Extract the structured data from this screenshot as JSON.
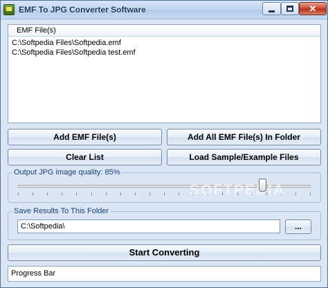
{
  "window": {
    "title": "EMF To JPG Converter Software",
    "close_glyph": "✕"
  },
  "file_list": {
    "header": "EMF File(s)",
    "items": [
      "C:\\Softpedia Files\\Softpedia.emf",
      "C:\\Softpedia Files\\Softpedia test.emf"
    ]
  },
  "buttons": {
    "add_files": "Add EMF File(s)",
    "add_all_in_folder": "Add All EMF File(s) In Folder",
    "clear_list": "Clear List",
    "load_samples": "Load Sample/Example Files",
    "browse": "...",
    "start_converting": "Start Converting"
  },
  "quality": {
    "label": "Output JPG image quality: 85%",
    "value_percent": 85
  },
  "output_folder": {
    "label": "Save Results To This Folder",
    "value": "C:\\Softpedia\\"
  },
  "progress": {
    "label": "Progress Bar"
  },
  "watermark": "SOFTPEDIA"
}
